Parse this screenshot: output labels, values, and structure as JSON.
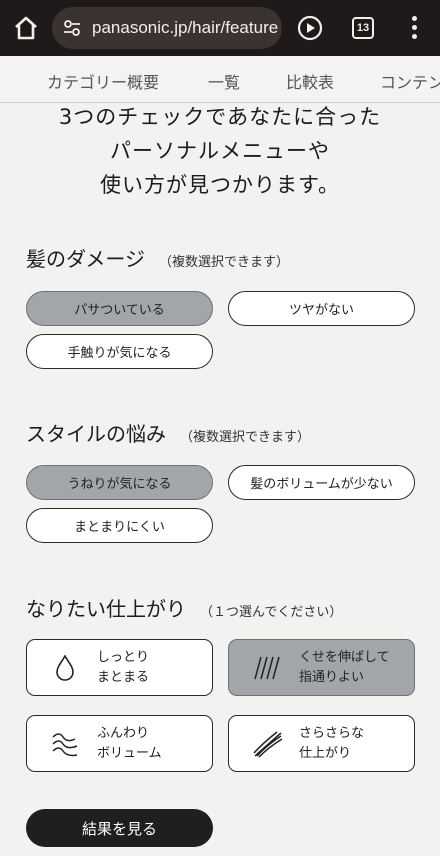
{
  "browser": {
    "url": "panasonic.jp/hair/feature",
    "tab_count": "13"
  },
  "topnav": {
    "items": [
      "カテゴリー概要",
      "一覧",
      "比較表",
      "コンテン"
    ]
  },
  "intro": {
    "lines": [
      "3つのチェックであなたに合った",
      "パーソナルメニューや",
      "使い方が見つかります。"
    ]
  },
  "damage": {
    "title": "髪のダメージ",
    "note": "（複数選択できます）",
    "options": [
      {
        "label": "パサついている",
        "selected": true
      },
      {
        "label": "ツヤがない",
        "selected": false
      },
      {
        "label": "手触りが気になる",
        "selected": false
      }
    ]
  },
  "style": {
    "title": "スタイルの悩み",
    "note": "（複数選択できます）",
    "options": [
      {
        "label": "うねりが気になる",
        "selected": true
      },
      {
        "label": "髪のボリュームが少ない",
        "selected": false
      },
      {
        "label": "まとまりにくい",
        "selected": false
      }
    ]
  },
  "finish": {
    "title": "なりたい仕上がり",
    "note": "（１つ選んでください）",
    "options": [
      {
        "line1": "しっとり",
        "line2": "まとまる",
        "icon": "droplet-icon",
        "selected": false
      },
      {
        "line1": "くせを伸ばして",
        "line2": "指通りよい",
        "icon": "straight-lines-icon",
        "selected": true
      },
      {
        "line1": "ふんわり",
        "line2": "ボリューム",
        "icon": "wavy-lines-icon",
        "selected": false
      },
      {
        "line1": "さらさらな",
        "line2": "仕上がり",
        "icon": "flowing-strands-icon",
        "selected": false
      }
    ]
  },
  "result_button": "結果を見る"
}
